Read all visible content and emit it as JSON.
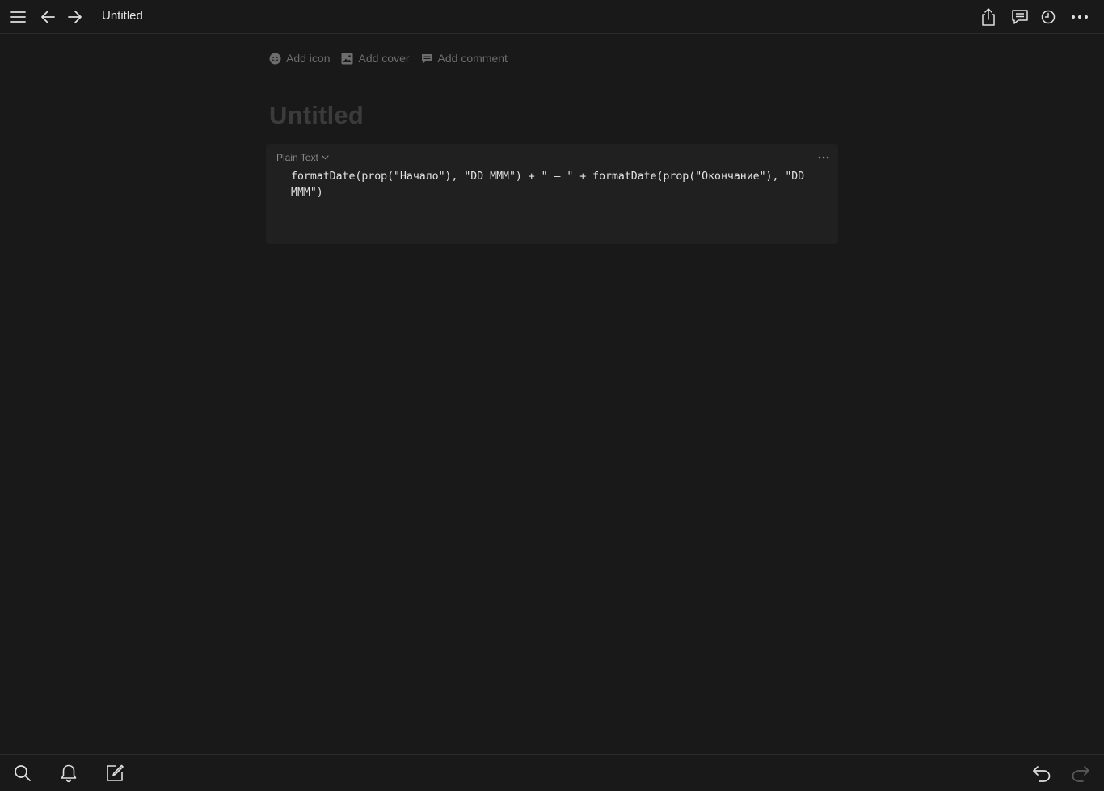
{
  "topbar": {
    "title": "Untitled",
    "icons": {
      "menu": "hamburger-menu-icon",
      "back": "arrow-left-icon",
      "forward": "arrow-right-icon",
      "share": "share-icon",
      "comments": "comment-icon",
      "history": "clock-icon",
      "more": "more-horizontal-icon"
    }
  },
  "page_actions": {
    "add_icon": "Add icon",
    "add_cover": "Add cover",
    "add_comment": "Add comment"
  },
  "page": {
    "title": "Untitled"
  },
  "code_block": {
    "language": "Plain Text",
    "content": "formatDate(prop(\"Начало\"), \"DD MMM\") + \" – \" + formatDate(prop(\"Окончание\"), \"DD MMM\")"
  },
  "bottombar": {
    "icons": {
      "search": "search-icon",
      "notifications": "bell-icon",
      "new_page": "compose-icon",
      "undo": "undo-icon",
      "redo": "redo-icon"
    }
  },
  "colors": {
    "background": "#191919",
    "code_background": "#202020",
    "title_placeholder": "#3b3b3b",
    "muted_text": "#6d6d6d"
  }
}
